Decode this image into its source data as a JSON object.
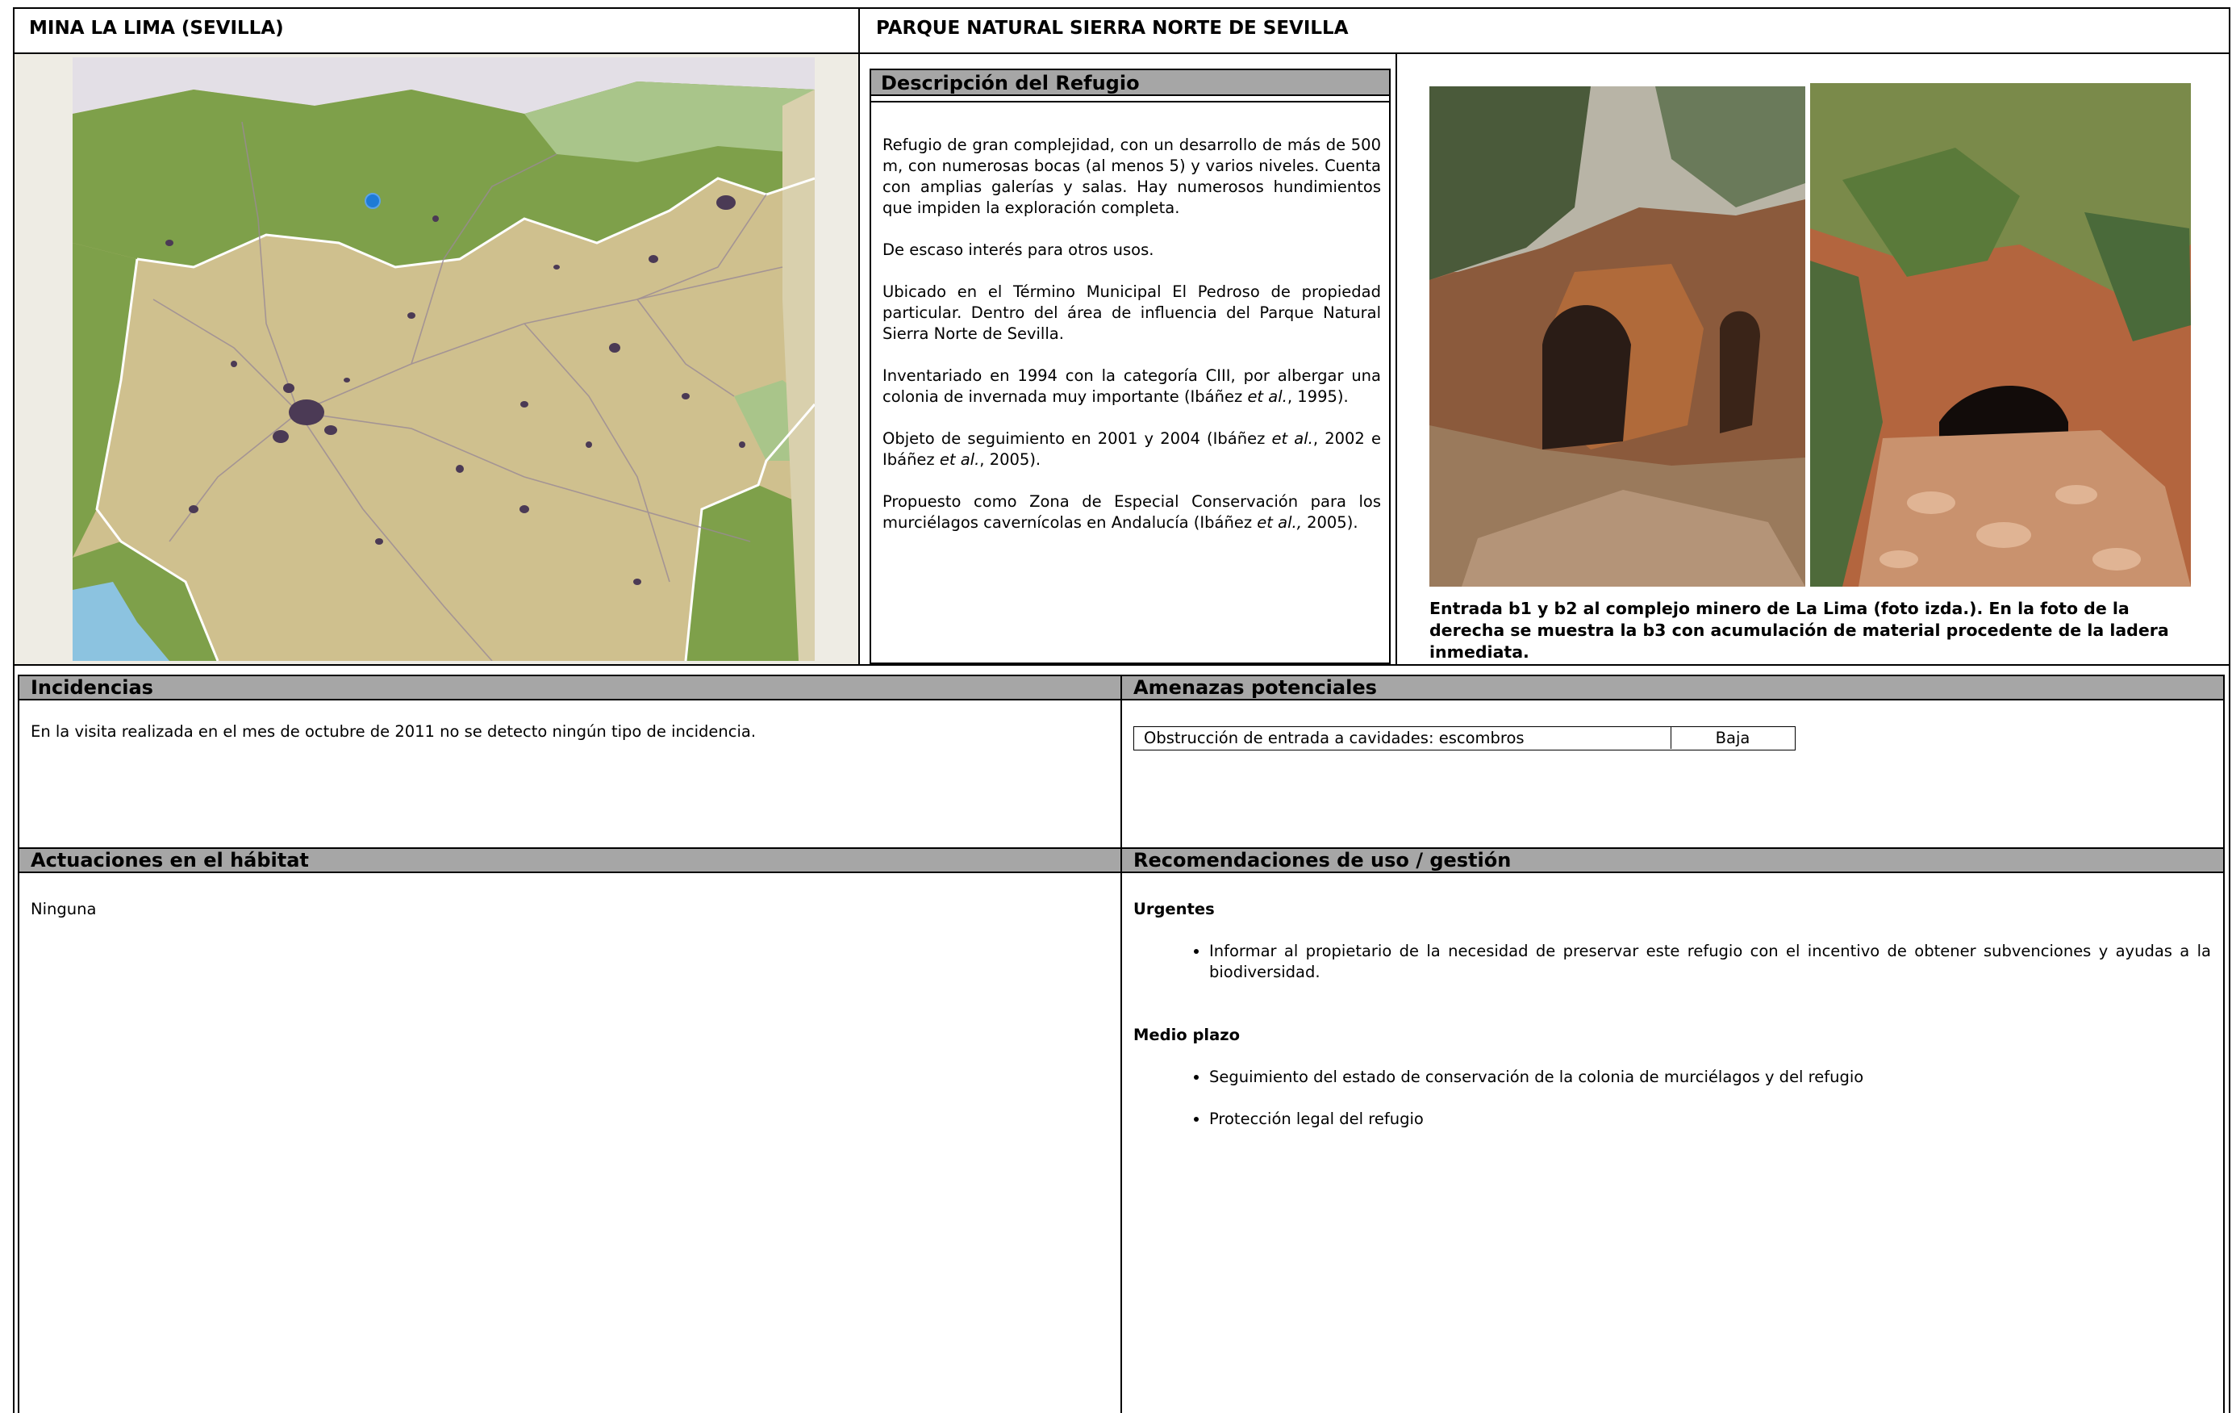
{
  "header": {
    "left_title": "MINA LA LIMA (SEVILLA)",
    "right_title": "PARQUE NATURAL SIERRA NORTE DE SEVILLA"
  },
  "map": {
    "icon": "location-map",
    "colors": {
      "park": "#7ea04a",
      "land": "#cfc08e",
      "sea": "#8cc3e0",
      "city": "#4b3a55",
      "marker": "#1e7bd6"
    }
  },
  "description": {
    "heading": "Descripción del Refugio",
    "paragraphs": [
      {
        "runs": [
          {
            "t": "Refugio de gran complejidad, con un desarrollo de más de 500 m, con numerosas bocas (al menos 5) y varios niveles. Cuenta con amplias galerías y salas. Hay numerosos hundimientos que impiden la exploración completa."
          }
        ]
      },
      {
        "runs": [
          {
            "t": "De escaso interés para otros usos."
          }
        ]
      },
      {
        "runs": [
          {
            "t": "Ubicado en el Término Municipal El Pedroso de propiedad particular. Dentro del área de influencia del Parque Natural Sierra Norte de Sevilla."
          }
        ]
      },
      {
        "runs": [
          {
            "t": "Inventariado en 1994 con la categoría CIII, por albergar una colonia de invernada muy importante (Ibáñez "
          },
          {
            "t": "et al.",
            "i": true
          },
          {
            "t": ", 1995)."
          }
        ]
      },
      {
        "runs": [
          {
            "t": "Objeto de seguimiento en 2001 y 2004 (Ibáñez "
          },
          {
            "t": "et al.",
            "i": true
          },
          {
            "t": ", 2002 e Ibáñez "
          },
          {
            "t": "et al.",
            "i": true
          },
          {
            "t": ", 2005)."
          }
        ]
      },
      {
        "runs": [
          {
            "t": "Propuesto como Zona de Especial Conservación para los murciélagos cavernícolas en Andalucía (Ibáñez "
          },
          {
            "t": "et al.,",
            "i": true
          },
          {
            "t": " 2005)."
          }
        ]
      }
    ]
  },
  "photos": {
    "caption": "Entrada b1 y b2 al complejo minero de La Lima (foto izda.). En la foto de la derecha se muestra la b3 con acumulación de material procedente de la ladera inmediata."
  },
  "incidencias": {
    "heading": "Incidencias",
    "text": "En la visita realizada en el mes de octubre de 2011 no se detecto ningún tipo de incidencia."
  },
  "amenazas": {
    "heading": "Amenazas potenciales",
    "threat": "Obstrucción de entrada a cavidades: escombros",
    "level": "Baja"
  },
  "actuaciones": {
    "heading": "Actuaciones en el hábitat",
    "text": "Ninguna"
  },
  "recomendaciones": {
    "heading": "Recomendaciones de uso / gestión",
    "urgent_label": "Urgentes",
    "urgent_items": [
      "Informar al propietario de la necesidad de preservar este refugio con el incentivo de obtener subvenciones y ayudas a la biodiversidad."
    ],
    "medium_label": "Medio plazo",
    "medium_items": [
      "Seguimiento del estado de conservación de la colonia de murciélagos y del refugio",
      "Protección legal del refugio"
    ]
  }
}
